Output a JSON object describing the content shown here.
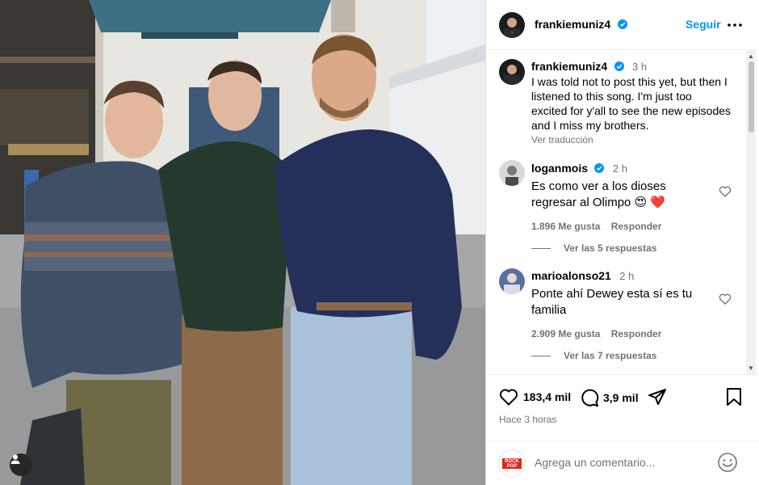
{
  "header": {
    "username": "frankiemuniz4",
    "follow_label": "Seguir"
  },
  "caption": {
    "username": "frankiemuniz4",
    "time": "3 h",
    "lines": [
      "I was told not to post this yet, but then I",
      "listened to this song. I'm just too",
      "excited for y'all to see the new episodes",
      "and I miss my brothers."
    ],
    "translate_label": "Ver traducción"
  },
  "comments": [
    {
      "username": "loganmois",
      "time": "2 h",
      "lines": [
        "Es como ver a los dioses",
        "regresar al Olimpo 😍 ❤️"
      ],
      "likes": "1.896 Me gusta",
      "reply_label": "Responder",
      "replies_label": "Ver las 5 respuestas"
    },
    {
      "username": "marioalonso21",
      "time": "2 h",
      "lines": [
        "Ponte ahí Dewey esta sí es tu",
        "familia"
      ],
      "likes": "2.909 Me gusta",
      "reply_label": "Responder",
      "replies_label": "Ver las 7 respuestas"
    }
  ],
  "actions": {
    "likes_count": "183,4 mil",
    "comments_count": "3,9 mil",
    "posted_ago": "Hace 3 horas"
  },
  "add_comment": {
    "placeholder": "Agrega un comentario...",
    "avatar_badge": "ROCK POP"
  },
  "colors": {
    "accent": "#0095f6",
    "verified": "#0095f6",
    "muted": "#737373",
    "heart_emoji": "#ed4956"
  },
  "icons": [
    "tag-user-icon",
    "verified-icon",
    "more-icon",
    "heart-icon",
    "comment-icon",
    "share-icon",
    "bookmark-icon",
    "emoji-icon"
  ]
}
